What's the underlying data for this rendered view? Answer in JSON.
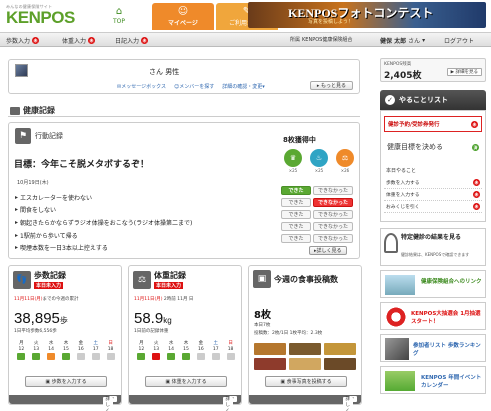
{
  "header": {
    "tagline": "みんなの健康保険サイト",
    "logo": "KENPOS",
    "tabs": [
      {
        "icon": "home-icon",
        "label": "TOP"
      },
      {
        "icon": "person-icon",
        "label": "マイページ"
      },
      {
        "icon": "info-icon",
        "label": "ご利用ガイド"
      }
    ],
    "banner_title": "KENPOSフォトコンテスト",
    "banner_sub": "写真を投稿しよう！"
  },
  "subbar": {
    "steps_entry": "歩数入力",
    "weight_entry": "体重入力",
    "diary_entry": "日記入力",
    "unregistered_mark": "未",
    "org_label": "所属",
    "org_name": "KENPOS健康保険組合",
    "user_name": "健保 太郎",
    "user_suffix": "さん",
    "logout": "ログアウト"
  },
  "profile": {
    "name_line": "さん 男性",
    "links": [
      "メッセージボックス",
      "メンバーを探す",
      "詳細の確認・変更"
    ],
    "more_button": "もっと見る"
  },
  "section_title": "健康記録",
  "action_record": {
    "title": "行動記録",
    "goal": "目標：今年こそ脱メタボするぞ！",
    "date": "10月19日(木)",
    "items": [
      "エスカレーターを使わない",
      "間食をしない",
      "朝起きたらかならずラジオ体操をおこなう(ラジオ体操第二まで)",
      "1駅前から歩いて帰る",
      "喫煙本数を一日3本以上控えする"
    ],
    "medals_title": "8枚獲得中",
    "medals": [
      {
        "label": "行動",
        "count": "25"
      },
      {
        "label": "食事",
        "count": "25"
      },
      {
        "label": "体重",
        "count": "26"
      }
    ],
    "statuses": [
      {
        "a": "できた",
        "b": "できなかった",
        "state": "done"
      },
      {
        "a": "できた",
        "b": "できなかった",
        "state": "fail"
      },
      {
        "a": "できた",
        "b": "できなかった",
        "state": "none"
      },
      {
        "a": "できた",
        "b": "できなかった",
        "state": "none"
      },
      {
        "a": "できた",
        "b": "できなかった",
        "state": "none"
      }
    ],
    "detail_button": "詳しく見る"
  },
  "steps_card": {
    "title": "歩数記録",
    "badge": "本日未入力",
    "date_red": "11月11日(月)",
    "date_rest": "までの今週の累計",
    "value": "38,895",
    "unit": "歩",
    "note": "1日平均歩数6,556歩",
    "days": [
      "月",
      "火",
      "水",
      "木",
      "金",
      "土",
      "日"
    ],
    "nums": [
      "12",
      "13",
      "14",
      "15",
      "16",
      "17",
      "18"
    ],
    "input_button": "歩数を入力する",
    "detail_button": "詳しく見る"
  },
  "weight_card": {
    "title": "体重記録",
    "badge": "本日未入力",
    "date_red": "11月11日(月)",
    "date_mid": "2時前",
    "date_rest": "11月 日",
    "value": "58.9",
    "unit": "kg",
    "note": "1日前の記録体重",
    "days": [
      "月",
      "火",
      "水",
      "木",
      "金",
      "土",
      "日"
    ],
    "nums": [
      "12",
      "13",
      "14",
      "15",
      "16",
      "17",
      "18"
    ],
    "input_button": "体重を入力する",
    "detail_button": "詳しく見る"
  },
  "meal_card": {
    "title": "今週の食事投稿数",
    "count": "8枚",
    "today": "本日7枚",
    "breakdown": "投稿数：2枚/1日 1枚平均：2.3枚",
    "input_button": "食事写真を投稿する",
    "detail_button": "詳しく見る"
  },
  "sidebar": {
    "points_label": "KENPOS残高",
    "points": "2,405枚",
    "points_button": "▶ 詳細を見る",
    "todo_title": "やることリスト",
    "todo_red": "健診予約/受診券発行",
    "todo_green": "健康目標を決める",
    "todo_today": "本日やること",
    "todo_items": [
      "歩数を入力する",
      "体重を入力する",
      "おみくじを引く"
    ],
    "kenko_title": "特定健診の結果を見る",
    "kenko_sub": "健診結果は、KENPOSで確認できます",
    "banners": [
      "健康保険組合へのリンク",
      "KENPOS大抽選会 1月抽選スタート！",
      "参加者リスト 歩数ランキング",
      "KENPOS 年間イベントカレンダー"
    ]
  }
}
